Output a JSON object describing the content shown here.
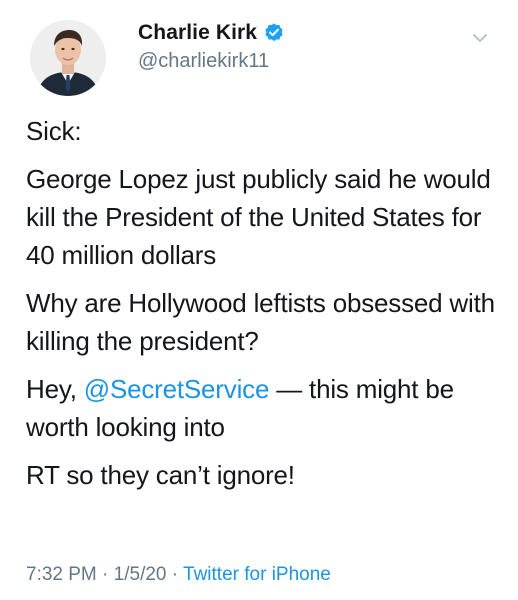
{
  "user": {
    "display_name": "Charlie Kirk",
    "handle": "@charliekirk11",
    "verified_icon": "verified-badge-icon",
    "avatar_icon": "avatar-photo"
  },
  "menu": {
    "icon": "chevron-down-icon"
  },
  "tweet": {
    "line1": "Sick:",
    "para2": "George Lopez just publicly said he would kill the President of the United States for 40 million dollars",
    "para3": "Why are Hollywood leftists obsessed with killing the president?",
    "para4_prefix": "Hey, ",
    "para4_mention": "@SecretService",
    "para4_suffix": " — this might be worth looking into",
    "para5": "RT so they can’t ignore!"
  },
  "meta": {
    "time": "7:32 PM",
    "sep1": " · ",
    "date": "1/5/20",
    "sep2": " · ",
    "source": "Twitter for iPhone"
  },
  "colors": {
    "link": "#1b95e0",
    "secondary_text": "#657786",
    "primary_text": "#14171a",
    "verified": "#1da1f2"
  }
}
